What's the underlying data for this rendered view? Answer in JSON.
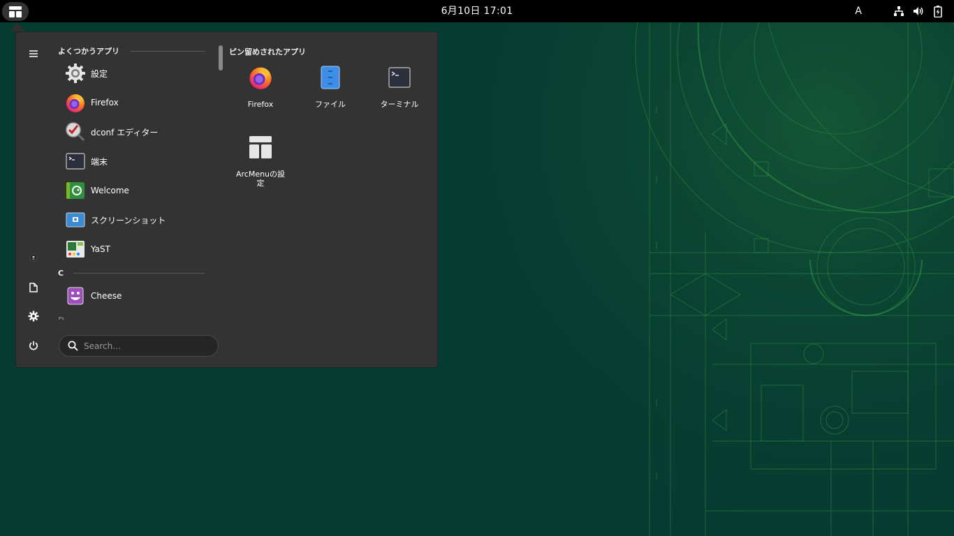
{
  "topbar": {
    "clock": "6月10日  17:01",
    "ime_indicator": "A",
    "icons": [
      "apps-menu-icon",
      "network-icon",
      "volume-icon",
      "battery-icon"
    ]
  },
  "menu": {
    "sidebar": {
      "icons": [
        "hamburger-icon",
        "user-avatar-icon",
        "document-icon",
        "settings-gear-icon",
        "power-icon"
      ]
    },
    "favorites_header": "よくつかうアプリ",
    "favorites": [
      {
        "label": "設定",
        "icon": "settings-icon"
      },
      {
        "label": "Firefox",
        "icon": "firefox-icon"
      },
      {
        "label": "dconf エディター",
        "icon": "dconf-editor-icon"
      },
      {
        "label": "端末",
        "icon": "terminal-icon"
      },
      {
        "label": "Welcome",
        "icon": "opensuse-welcome-icon"
      },
      {
        "label": "スクリーンショット",
        "icon": "screenshot-icon"
      },
      {
        "label": "YaST",
        "icon": "yast-icon"
      }
    ],
    "letter_c": "C",
    "c_apps": [
      {
        "label": "Cheese",
        "icon": "cheese-icon"
      }
    ],
    "letter_d": "D",
    "search_placeholder": "Search…",
    "pinned_header": "ピン留めされたアプリ",
    "pinned": [
      {
        "label": "Firefox",
        "icon": "firefox-icon"
      },
      {
        "label": "ファイル",
        "icon": "files-icon"
      },
      {
        "label": "ターミナル",
        "icon": "terminal-icon"
      },
      {
        "label": "ArcMenuの設\n定",
        "icon": "arcmenu-settings-icon"
      }
    ]
  },
  "colors": {
    "topbar": "#000000",
    "desktop": "#063b31",
    "menu_bg": "#333333",
    "wallpaper_lines": "#2e7a3f"
  }
}
